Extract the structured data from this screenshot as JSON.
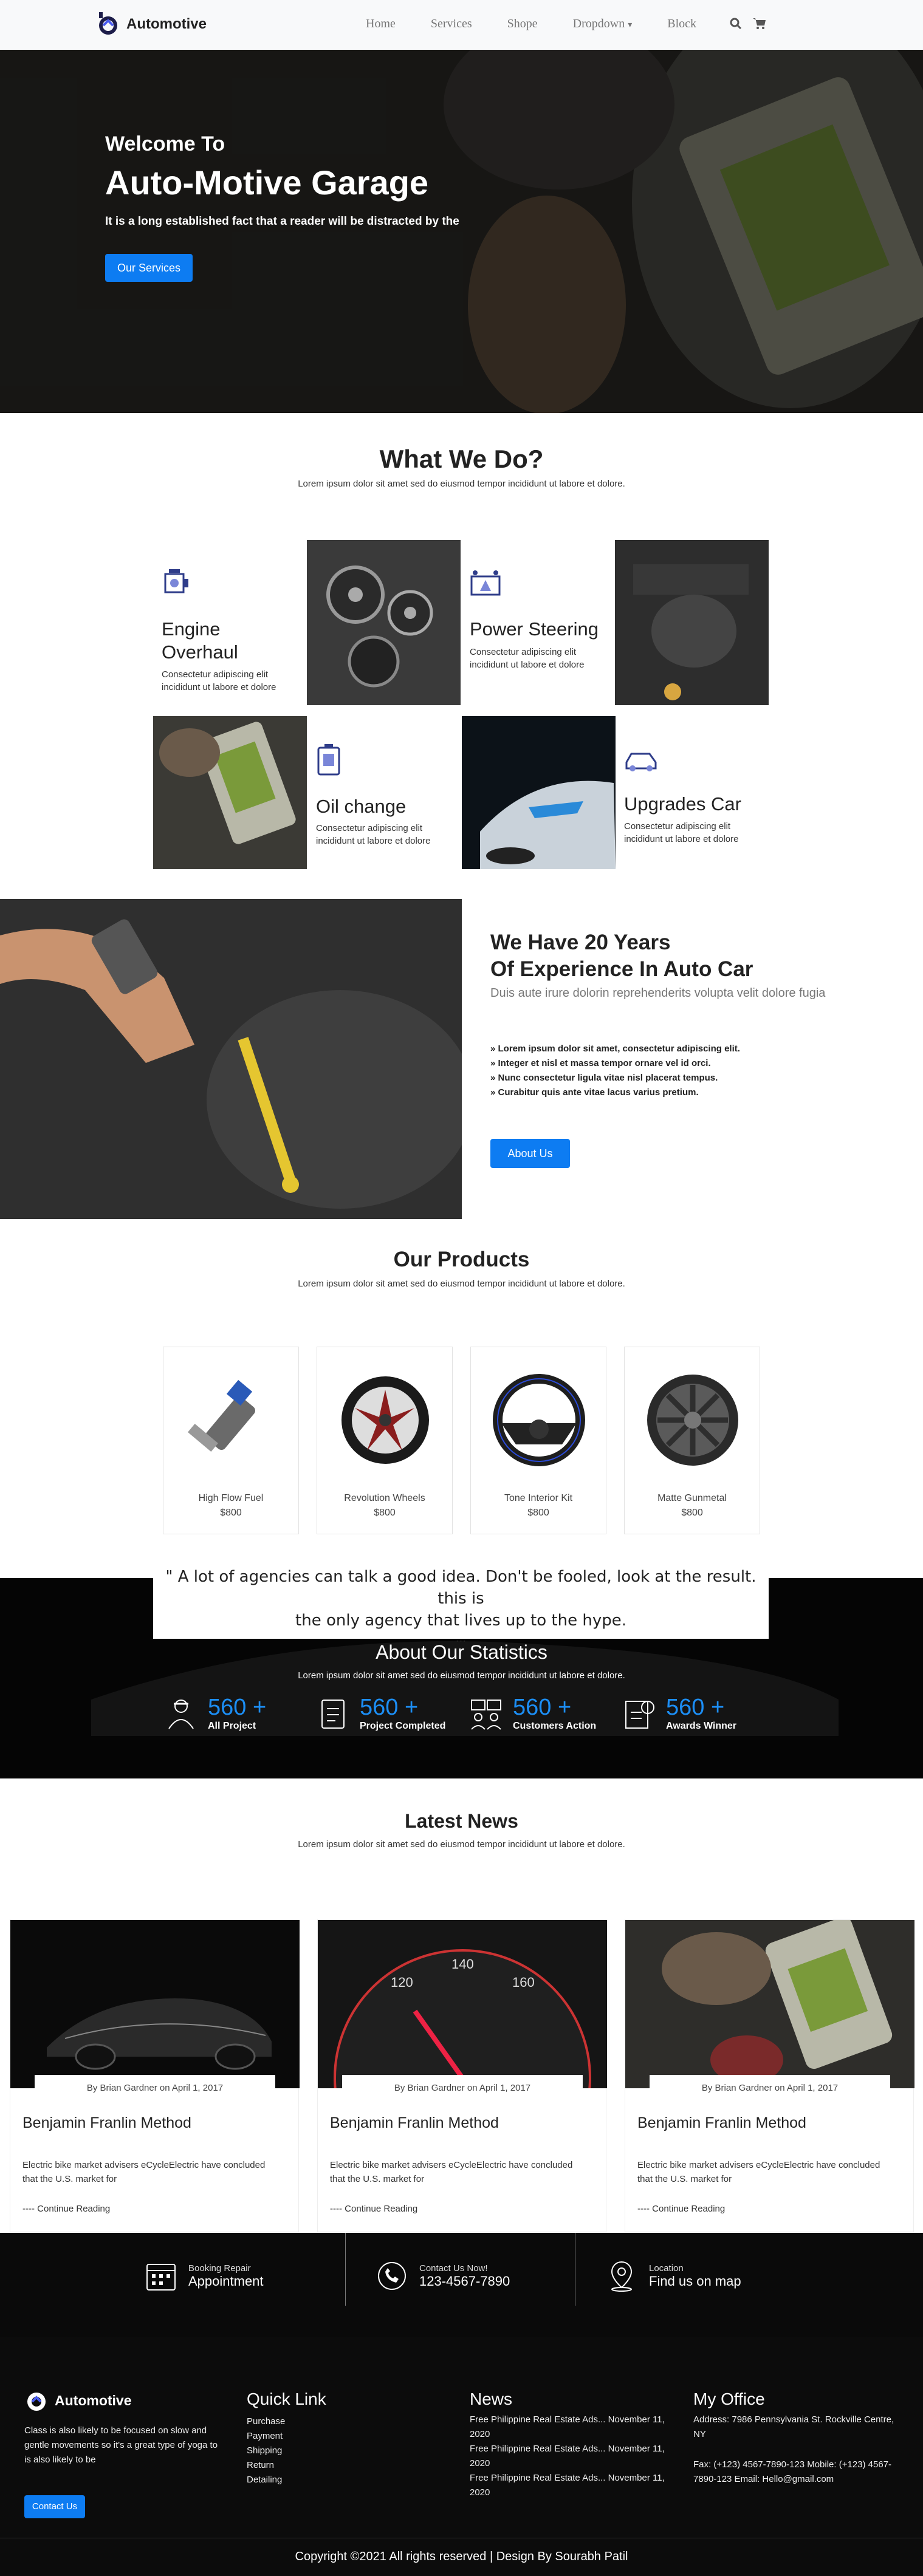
{
  "nav": {
    "brand": "Automotive",
    "links": [
      "Home",
      "Services",
      "Shope",
      "Dropdown",
      "Block"
    ],
    "dropdown_caret": "▾"
  },
  "hero": {
    "welcome": "Welcome To",
    "title": "Auto-Motive Garage",
    "tagline": "It is a long established fact that a reader will be distracted by the",
    "button": "Our Services"
  },
  "services": {
    "title": "What We Do?",
    "subtitle": "Lorem ipsum dolor sit amet sed do eiusmod tempor incididunt ut labore et dolore.",
    "items": [
      {
        "title": "Engine Overhaul",
        "text": "Consectetur adipiscing elit incididunt ut labore et dolore"
      },
      {
        "title": "Power Steering",
        "text": "Consectetur adipiscing elit incididunt ut labore et dolore"
      },
      {
        "title": "Oil change",
        "text": "Consectetur adipiscing elit incididunt ut labore et dolore"
      },
      {
        "title": "Upgrades Car",
        "text": "Consectetur adipiscing elit incididunt ut labore et dolore"
      }
    ]
  },
  "experience": {
    "title_line1": "We Have 20 Years",
    "title_line2": "Of Experience In Auto Car",
    "subtitle": "Duis aute irure dolorin reprehenderits volupta velit dolore fugia",
    "bullets": [
      "» Lorem ipsum dolor sit amet, consectetur adipiscing elit.",
      "» Integer et nisl et massa tempor ornare vel id orci.",
      "» Nunc consectetur ligula vitae nisl placerat tempus.",
      "» Curabitur quis ante vitae lacus varius pretium."
    ],
    "button": "About Us"
  },
  "products": {
    "title": "Our Products",
    "subtitle": "Lorem ipsum dolor sit amet sed do eiusmod tempor incididunt ut labore et dolore.",
    "items": [
      {
        "name": "High Flow Fuel",
        "price": "$800"
      },
      {
        "name": "Revolution Wheels",
        "price": "$800"
      },
      {
        "name": "Tone Interior Kit",
        "price": "$800"
      },
      {
        "name": "Matte Gunmetal",
        "price": "$800"
      }
    ]
  },
  "quote": {
    "line1": "\" A lot of agencies can talk a good idea. Don't be fooled, look at the result. this is",
    "line2": "the only agency that lives up to the hype.",
    "line3": "..."
  },
  "stats": {
    "title": "About Our Statistics",
    "subtitle": "Lorem ipsum dolor sit amet sed do eiusmod tempor incididunt ut labore et dolore.",
    "items": [
      {
        "value": "560 +",
        "label": "All Project"
      },
      {
        "value": "560 +",
        "label": "Project Completed"
      },
      {
        "value": "560 +",
        "label": "Customers Action"
      },
      {
        "value": "560 +",
        "label": "Awards Winner"
      }
    ]
  },
  "news": {
    "title": "Latest News",
    "subtitle": "Lorem ipsum dolor sit amet sed do eiusmod tempor incididunt ut labore et dolore.",
    "items": [
      {
        "byline": "By Brian Gardner on April 1, 2017",
        "title": "Benjamin Franlin Method",
        "text": "Electric bike market advisers eCycleElectric have concluded that the U.S. market for",
        "more": "---- Continue Reading"
      },
      {
        "byline": "By Brian Gardner on April 1, 2017",
        "title": "Benjamin Franlin Method",
        "text": "Electric bike market advisers eCycleElectric have concluded that the U.S. market for",
        "more": "---- Continue Reading"
      },
      {
        "byline": "By Brian Gardner on April 1, 2017",
        "title": "Benjamin Franlin Method",
        "text": "Electric bike market advisers eCycleElectric have concluded that the U.S. market for",
        "more": "---- Continue Reading"
      }
    ]
  },
  "contact_bar": [
    {
      "small": "Booking Repair",
      "big": "Appointment"
    },
    {
      "small": "Contact Us Now!",
      "big": "123-4567-7890"
    },
    {
      "small": "Location",
      "big": "Find us on map"
    }
  ],
  "footer": {
    "brand": "Automotive",
    "about": "Class is also likely to be focused on slow and gentle movements so it's a great type of yoga to is also likely to be",
    "contact_button": "Contact Us",
    "quick_link_title": "Quick Link",
    "quick_links": [
      "Purchase",
      "Payment",
      "Shipping",
      "Return",
      "Detailing"
    ],
    "news_title": "News",
    "news_items": [
      "Free Philippine Real Estate Ads... November 11, 2020",
      "Free Philippine Real Estate Ads... November 11, 2020",
      "Free Philippine Real Estate Ads... November 11, 2020"
    ],
    "office_title": "My Office",
    "office_address": "Address: 7986 Pennsylvania St. Rockville Centre, NY",
    "office_contact": "Fax: (+123) 4567-7890-123 Mobile: (+123) 4567-7890-123 Email: Hello@gmail.com",
    "copyright": "Copyright ©2021 All rights reserved | Design By Sourabh Patil"
  },
  "colors": {
    "accent": "#0d7cf2",
    "stat_number": "#1c8ef5",
    "dark": "#050505"
  }
}
